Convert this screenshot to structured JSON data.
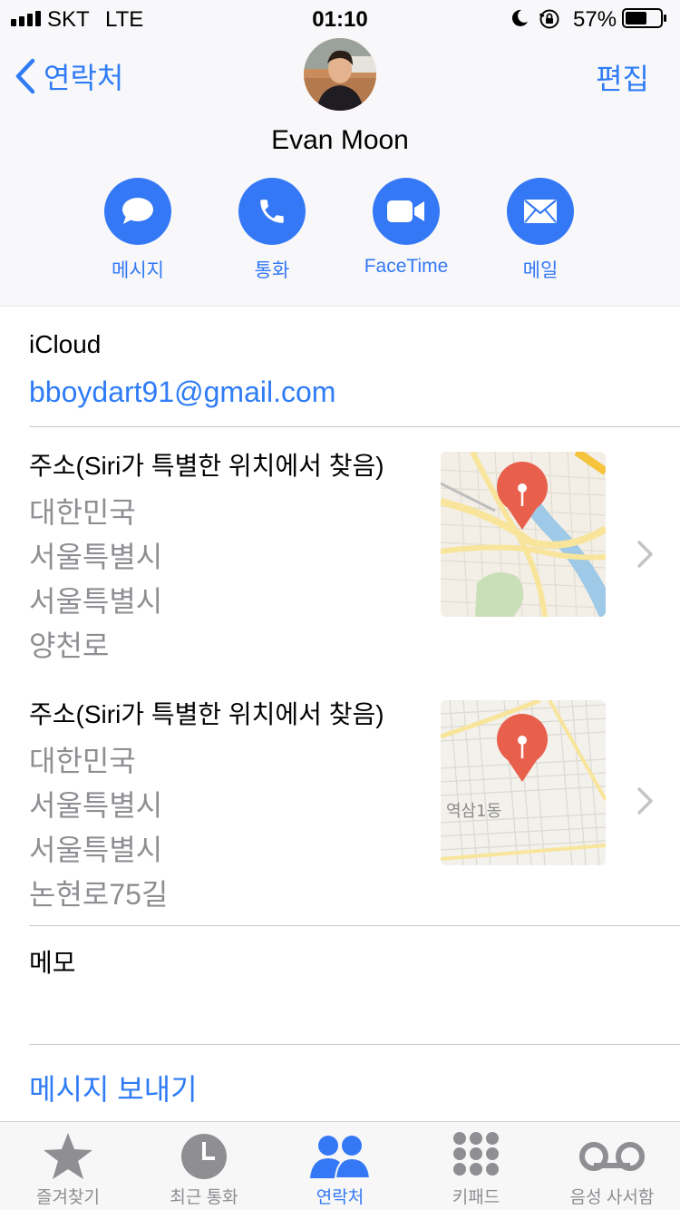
{
  "status_bar": {
    "carrier": "SKT",
    "network": "LTE",
    "time": "01:10",
    "battery": "57%",
    "icons": [
      "signal-icon",
      "moon-icon",
      "orientation-lock-icon",
      "battery-icon"
    ]
  },
  "nav": {
    "back_label": "연락처",
    "edit_label": "편집"
  },
  "contact": {
    "name": "Evan Moon"
  },
  "actions": [
    {
      "label": "메시지",
      "icon": "message-icon"
    },
    {
      "label": "통화",
      "icon": "phone-icon"
    },
    {
      "label": "FaceTime",
      "icon": "video-icon"
    },
    {
      "label": "메일",
      "icon": "mail-icon"
    }
  ],
  "email_section": {
    "label": "iCloud",
    "value": "bboydart91@gmail.com"
  },
  "addresses": [
    {
      "label": "주소(Siri가 특별한 위치에서 찾음)",
      "lines": [
        "대한민국",
        "서울특별시",
        "서울특별시",
        "양천로"
      ],
      "map_label": ""
    },
    {
      "label": "주소(Siri가 특별한 위치에서 찾음)",
      "lines": [
        "대한민국",
        "서울특별시",
        "서울특별시",
        "논현로75길"
      ],
      "map_label": "역삼1동"
    }
  ],
  "memo": {
    "label": "메모"
  },
  "send_message": "메시지 보내기",
  "tab_bar": {
    "active": "연락처",
    "tabs": [
      {
        "label": "즐겨찾기",
        "icon": "star-icon"
      },
      {
        "label": "최근 통화",
        "icon": "clock-icon"
      },
      {
        "label": "연락처",
        "icon": "contacts-icon"
      },
      {
        "label": "키패드",
        "icon": "keypad-icon"
      },
      {
        "label": "음성 사서함",
        "icon": "voicemail-icon"
      }
    ]
  },
  "colors": {
    "accent": "#3478f6",
    "link": "#2f7cf6",
    "secondary_text": "#8e8e93",
    "header_bg": "#f8f8fa",
    "pin": "#e8604c"
  }
}
